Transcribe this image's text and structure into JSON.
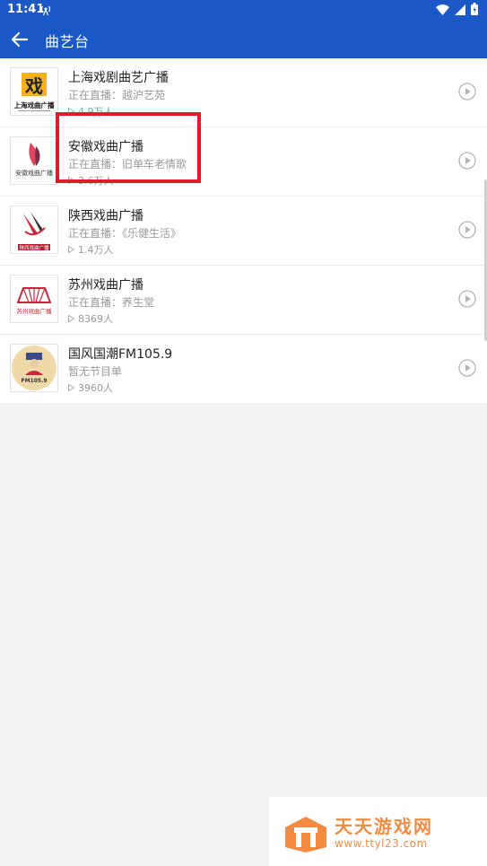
{
  "status_bar": {
    "time": "11:41"
  },
  "app_bar": {
    "title": "曲艺台"
  },
  "stations": [
    {
      "name": "上海戏剧曲艺广播",
      "program": "正在直播：越沪艺苑",
      "listeners": "4.9万人",
      "logo_text": "上海戏曲广播"
    },
    {
      "name": "安徽戏曲广播",
      "program": "正在直播：旧单车老情歌",
      "listeners": "3.6万人",
      "logo_text": "安徽戏曲广播"
    },
    {
      "name": "陕西戏曲广播",
      "program": "正在直播：《乐健生活》",
      "listeners": "1.4万人",
      "logo_text": "陕西戏曲广播"
    },
    {
      "name": "苏州戏曲广播",
      "program": "正在直播：养生堂",
      "listeners": "8369人",
      "logo_text": "苏州戏曲广播"
    },
    {
      "name": "国风国潮FM105.9",
      "program": "暂无节目单",
      "listeners": "3960人",
      "logo_text": "FM105.9"
    }
  ],
  "watermark": {
    "title": "天天游戏网",
    "url": "www.ttyl23.com"
  },
  "colors": {
    "primary": "#1a57c7",
    "highlight": "#e21b2c",
    "watermark": "#f28b42"
  }
}
